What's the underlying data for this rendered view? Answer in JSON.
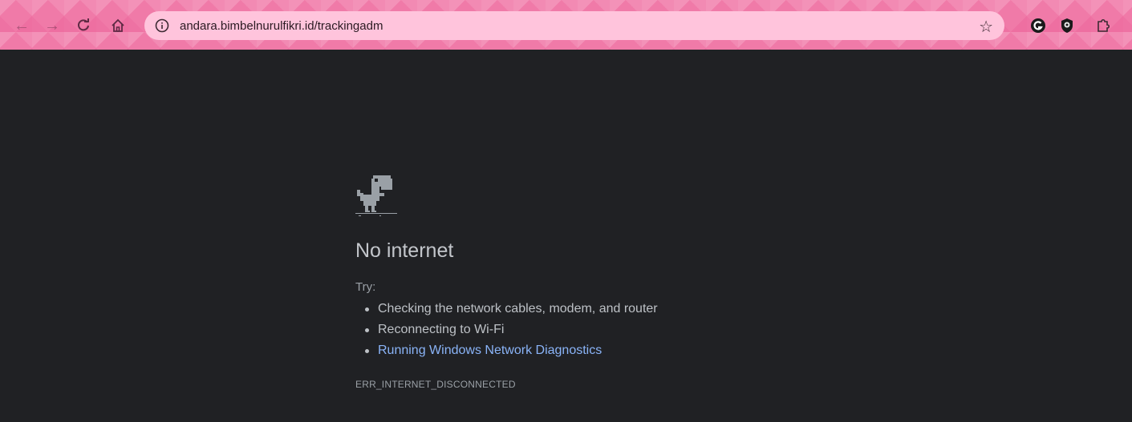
{
  "browser": {
    "url": "andara.bimbelnurulfikri.id/trackingadm",
    "icons": {
      "back": "back-arrow-icon",
      "forward": "forward-arrow-icon",
      "reload": "reload-icon",
      "home": "home-icon",
      "site_info": "info-icon",
      "bookmark": "star-icon",
      "extensions": [
        "grammar-extension-icon",
        "shield-extension-icon",
        "puzzle-extensions-icon"
      ]
    },
    "theme_color": "#f07aa8"
  },
  "error_page": {
    "title": "No internet",
    "try_label": "Try:",
    "suggestions": [
      "Checking the network cables, modem, and router",
      "Reconnecting to Wi-Fi",
      "Running Windows Network Diagnostics"
    ],
    "error_code": "ERR_INTERNET_DISCONNECTED",
    "link_color": "#8ab4f8",
    "background": "#202124"
  }
}
